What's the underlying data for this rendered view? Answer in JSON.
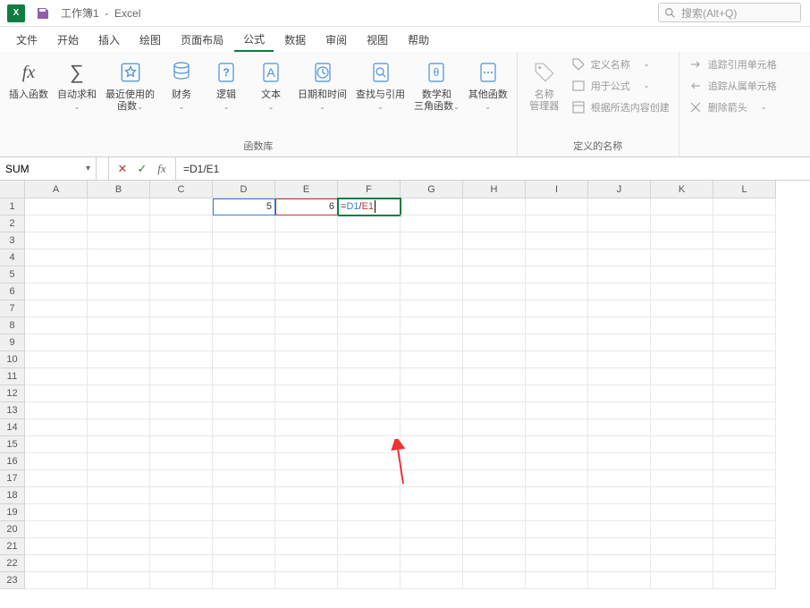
{
  "title": {
    "workbook": "工作簿1",
    "app": "Excel"
  },
  "search": {
    "placeholder": "搜索(Alt+Q)"
  },
  "tabs": [
    "文件",
    "开始",
    "插入",
    "绘图",
    "页面布局",
    "公式",
    "数据",
    "审阅",
    "视图",
    "帮助"
  ],
  "active_tab_index": 5,
  "ribbon": {
    "insert_fn": "插入函数",
    "autosum": "自动求和",
    "recent": "最近使用的\n函数",
    "finance": "财务",
    "logic": "逻辑",
    "text": "文本",
    "datetime": "日期和时间",
    "lookup": "查找与引用",
    "math": "数学和\n三角函数",
    "other": "其他函数",
    "group_funclib": "函数库",
    "name_mgr": "名称\n管理器",
    "def_name": "定义名称",
    "use_formula": "用于公式",
    "from_sel": "根据所选内容创建",
    "group_defnames": "定义的名称",
    "trace_prec": "追踪引用单元格",
    "trace_dep": "追踪从属单元格",
    "remove_arrows": "删除箭头",
    "down_chev": "⌄"
  },
  "namebox": "SUM",
  "formula": "=D1/E1",
  "formula_parts": {
    "eq": "=",
    "d": "D1",
    "op": "/",
    "e": "E1"
  },
  "columns": [
    "A",
    "B",
    "C",
    "D",
    "E",
    "F",
    "G",
    "H",
    "I",
    "J",
    "K",
    "L"
  ],
  "rows": 23,
  "cells": {
    "D1": "5",
    "E1": "6"
  }
}
